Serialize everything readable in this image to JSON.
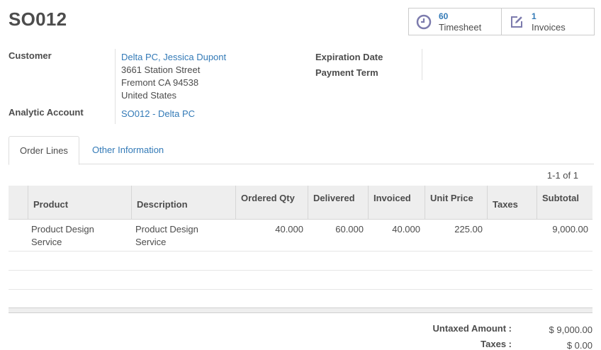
{
  "record": {
    "title": "SO012"
  },
  "smart_buttons": {
    "timesheet": {
      "count": "60",
      "label": "Timesheet",
      "icon": "clock-icon"
    },
    "invoices": {
      "count": "1",
      "label": "Invoices",
      "icon": "pencil-square-icon"
    }
  },
  "form": {
    "customer_label": "Customer",
    "customer_name": "Delta PC, Jessica Dupont",
    "address_line1": "3661 Station Street",
    "address_line2": "Fremont CA 94538",
    "address_line3": "United States",
    "analytic_label": "Analytic Account",
    "analytic_value": "SO012 - Delta PC",
    "expiration_label": "Expiration Date",
    "payment_term_label": "Payment Term"
  },
  "tabs": [
    {
      "label": "Order Lines",
      "active": true
    },
    {
      "label": "Other Information",
      "active": false
    }
  ],
  "pager": {
    "text": "1-1 of 1"
  },
  "table": {
    "headers": {
      "product": "Product",
      "description": "Description",
      "ordered_qty": "Ordered Qty",
      "delivered": "Delivered",
      "invoiced": "Invoiced",
      "unit_price": "Unit Price",
      "taxes": "Taxes",
      "subtotal": "Subtotal"
    },
    "rows": [
      {
        "product_l1": "Product Design",
        "product_l2": "Service",
        "description_l1": "Product Design",
        "description_l2": "Service",
        "ordered_qty": "40.000",
        "delivered": "60.000",
        "invoiced": "40.000",
        "unit_price": "225.00",
        "taxes": "",
        "subtotal": "9,000.00"
      }
    ]
  },
  "totals": {
    "untaxed_label": "Untaxed Amount :",
    "untaxed_value": "$ 9,000.00",
    "taxes_label": "Taxes :",
    "taxes_value": "$ 0.00"
  },
  "colors": {
    "link": "#337ab7",
    "text": "#4c4c4c",
    "header_bg": "#eeeeee"
  }
}
